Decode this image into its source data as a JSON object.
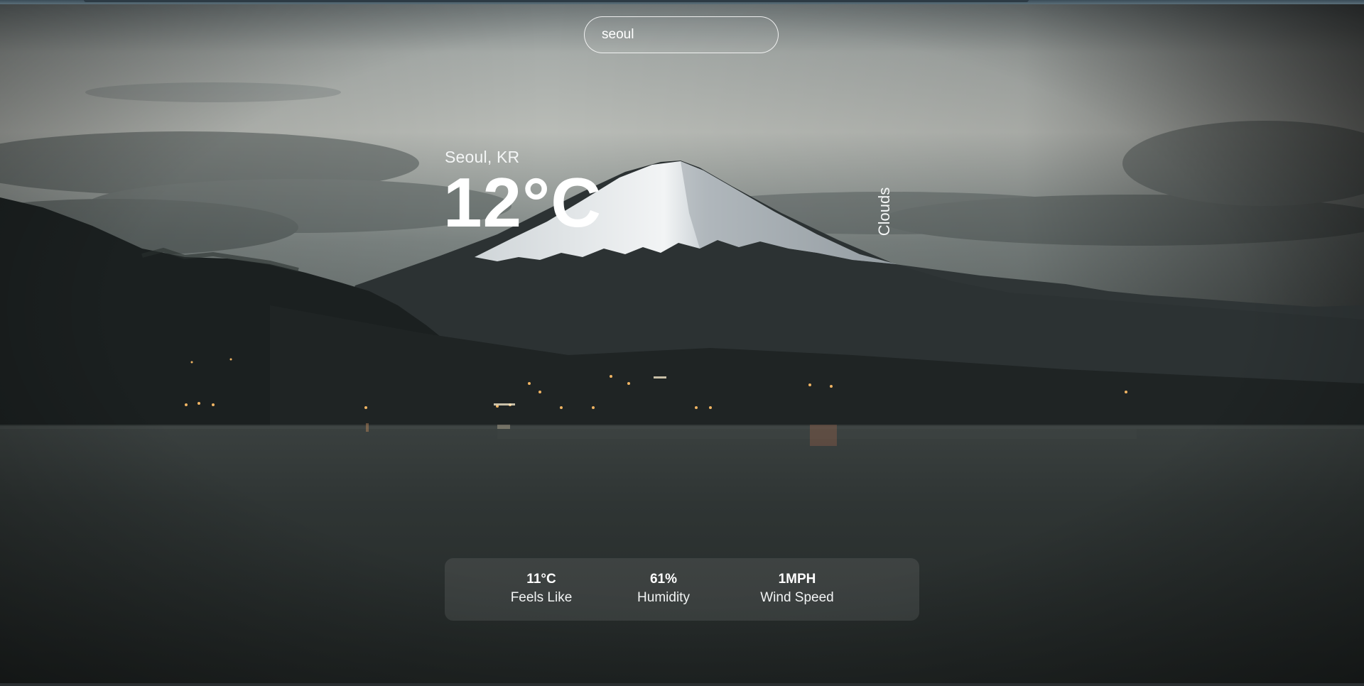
{
  "search": {
    "value": "seoul"
  },
  "weather": {
    "location": "Seoul, KR",
    "temperature": "12°C",
    "condition": "Clouds"
  },
  "stats": [
    {
      "value": "11°C",
      "label": "Feels Like"
    },
    {
      "value": "61%",
      "label": "Humidity"
    },
    {
      "value": "1MPH",
      "label": "Wind Speed"
    }
  ],
  "colors": {
    "sky_top": "#c4c7c3",
    "sky_bottom": "#5f6766",
    "mountain": "#2a2f30",
    "snow": "#e8ecee",
    "water": "#2a2f2e",
    "text": "#ffffff",
    "stats_panel": "rgba(255,255,255,0.09)"
  },
  "background": {
    "subject": "snow-capped-mountain-at-dusk-over-lake"
  }
}
